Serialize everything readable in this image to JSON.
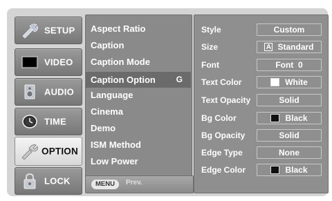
{
  "nav": {
    "items": [
      {
        "label": "SETUP",
        "icon": "setup-icon",
        "active": false
      },
      {
        "label": "VIDEO",
        "icon": "video-icon",
        "active": false
      },
      {
        "label": "AUDIO",
        "icon": "audio-icon",
        "active": false
      },
      {
        "label": "TIME",
        "icon": "time-icon",
        "active": false
      },
      {
        "label": "OPTION",
        "icon": "option-icon",
        "active": true
      },
      {
        "label": "LOCK",
        "icon": "lock-icon",
        "active": false
      }
    ]
  },
  "menu": {
    "items": [
      "Aspect Ratio",
      "Caption",
      "Caption Mode",
      "Caption Option",
      "Language",
      "Cinema",
      "Demo",
      "ISM Method",
      "Low Power"
    ],
    "selected": "Caption Option",
    "selected_key": "G",
    "footer_button": "MENU",
    "footer_label": "Prev."
  },
  "options": [
    {
      "label": "Style",
      "value": "Custom"
    },
    {
      "label": "Size",
      "value": "Standard",
      "badge": "A"
    },
    {
      "label": "Font",
      "value": "Font  0"
    },
    {
      "label": "Text Color",
      "value": "White",
      "swatch": "#ffffff"
    },
    {
      "label": "Text Opacity",
      "value": "Solid"
    },
    {
      "label": "Bg Color",
      "value": "Black",
      "swatch": "#111111"
    },
    {
      "label": "Bg Opacity",
      "value": "Solid"
    },
    {
      "label": "Edge Type",
      "value": "None"
    },
    {
      "label": "Edge Color",
      "value": "Black",
      "swatch": "#111111"
    }
  ],
  "colors": {
    "panel": "#8a8a8a",
    "highlight": "#6b6b6b",
    "frame": "#d4d4d4"
  }
}
